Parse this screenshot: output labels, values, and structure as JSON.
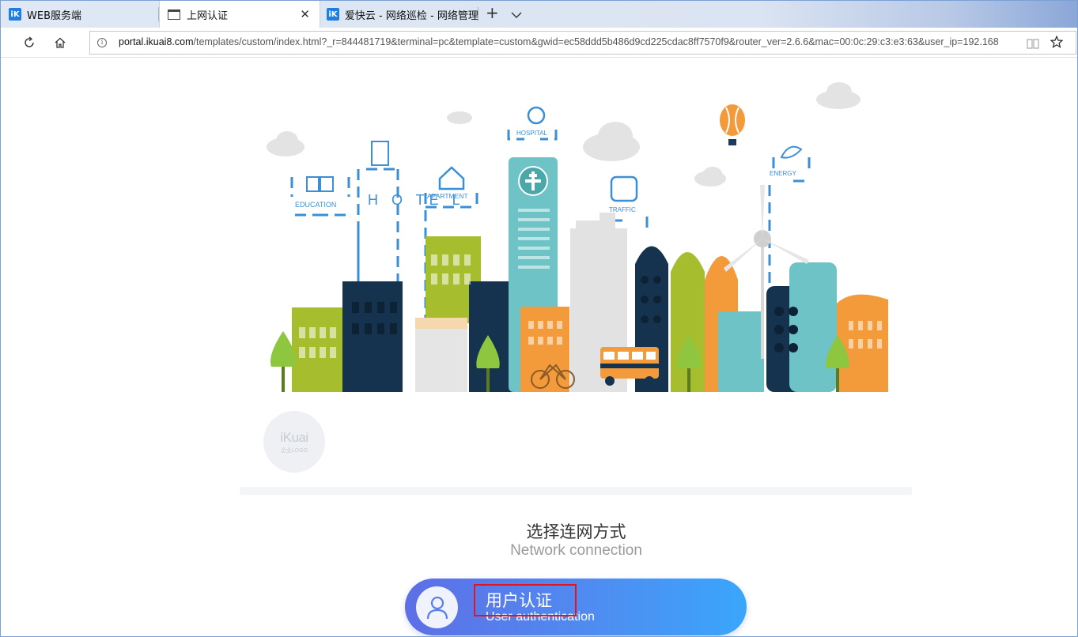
{
  "tabs": [
    {
      "label": "WEB服务端",
      "icon": "ikuai-favicon"
    },
    {
      "label": "上网认证",
      "icon": "page-icon",
      "active": true
    },
    {
      "label": "爱快云 - 网络巡检 - 网络管理",
      "icon": "ikuai-favicon"
    }
  ],
  "tab_icon_text": "iK",
  "tab_close": "✕",
  "new_tab": "+",
  "tab_menu": "⌄",
  "address": {
    "host": "portal.ikuai8.com",
    "path": "/templates/custom/index.html?_r=844481719&terminal=pc&template=custom&gwid=ec58ddd5b486d9cd225cdac8ff7570f9&router_ver=2.6.6&mac=00:0c:29:c3:e3:63&user_ip=192.168",
    "info": "i"
  },
  "banner_labels": {
    "education": "EDUCATION",
    "hotel": "H O TE L",
    "apartment": "APARTMENT",
    "hospital": "HOSPITAL",
    "traffic": "TRAFFIC",
    "energy": "ENERGY"
  },
  "logo": {
    "main": "iKuai",
    "sub": "企业LOGO"
  },
  "section": {
    "title": "选择连网方式",
    "subtitle": "Network connection"
  },
  "auth_button": {
    "label": "用户认证",
    "sublabel": "User authentication"
  },
  "colors": {
    "accent_start": "#5e6fe6",
    "accent_end": "#3aa6fb",
    "highlight": "#e3141b"
  }
}
